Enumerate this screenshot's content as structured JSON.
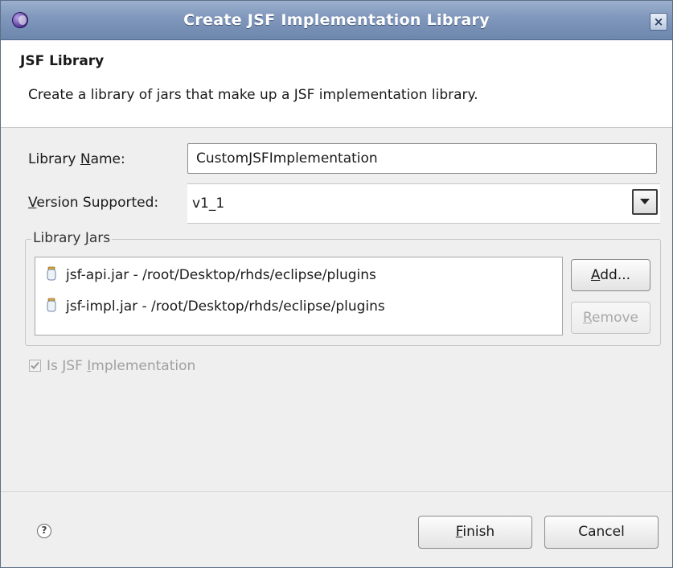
{
  "window": {
    "title": "Create JSF Implementation Library",
    "close_glyph": "×",
    "icon": "eclipse-icon"
  },
  "banner": {
    "title": "JSF Library",
    "description": "Create a library of jars that make up a JSF implementation library."
  },
  "form": {
    "library_name": {
      "label_pre": "Library ",
      "label_mnemonic": "N",
      "label_post": "ame:",
      "value": "CustomJSFImplementation"
    },
    "version": {
      "label_mnemonic": "V",
      "label_post": "ersion Supported:",
      "value": "v1_1"
    }
  },
  "library_jars": {
    "label_pre": "Library ",
    "label_mnemonic": "J",
    "label_post": "ars",
    "items": [
      {
        "text": "jsf-api.jar - /root/Desktop/rhds/eclipse/plugins",
        "icon": "jar-icon"
      },
      {
        "text": "jsf-impl.jar - /root/Desktop/rhds/eclipse/plugins",
        "icon": "jar-icon"
      }
    ],
    "add_button": {
      "mnemonic": "A",
      "rest": "dd..."
    },
    "remove_button": {
      "mnemonic": "R",
      "rest": "emove"
    }
  },
  "is_jsf_impl": {
    "label_pre": "Is JSF ",
    "label_mnemonic": "I",
    "label_post": "mplementation",
    "checked": true,
    "enabled": false
  },
  "footer": {
    "help_glyph": "?",
    "finish": {
      "mnemonic": "F",
      "rest": "inish"
    },
    "cancel": "Cancel"
  },
  "colors": {
    "titlebar": "#7f97bb",
    "dialog_bg": "#efefef",
    "banner_bg": "#ffffff",
    "disabled_text": "#a0a0a0"
  }
}
